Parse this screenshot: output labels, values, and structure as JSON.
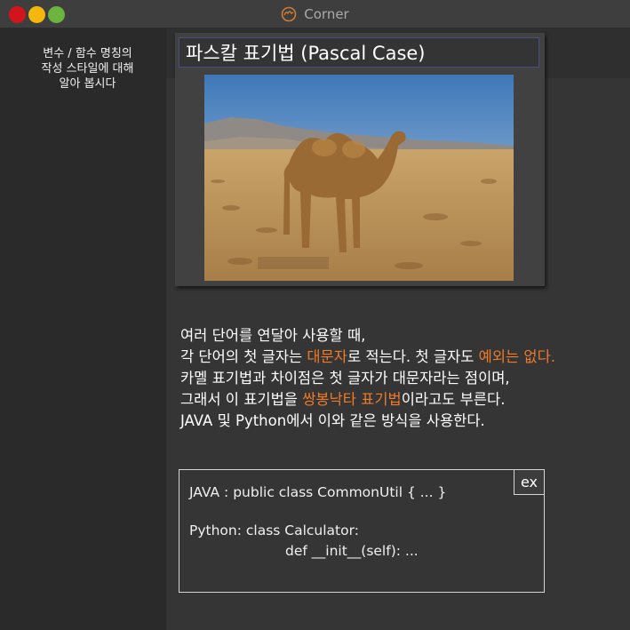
{
  "window": {
    "title": "Corner",
    "logo_icon": "camel-logo-icon"
  },
  "sidebar": {
    "lines": [
      "변수 / 함수 명칭의",
      "작성 스타일에 대해",
      "알아 봅시다"
    ]
  },
  "card": {
    "title": "파스칼 표기법 (Pascal Case)",
    "image": "camel-photo"
  },
  "description": {
    "line1": "여러 단어를 연달아 사용할 때,",
    "line2_a": "각 단어의 첫 글자는 ",
    "line2_hl1": "대문자",
    "line2_b": "로 적는다. 첫 글자도 ",
    "line2_hl2": "예외는 없다",
    "line2_c": ".",
    "line3": "카멜 표기법과 차이점은 첫 글자가 대문자라는 점이며,",
    "line4_a": "그래서 이 표기법을 ",
    "line4_hl": "쌍봉낙타 표기법",
    "line4_b": "이라고도 부른다.",
    "line5": "JAVA 및 Python에서 이와 같은 방식을 사용한다.",
    "highlight_color": "#ee7a2a"
  },
  "example": {
    "badge": "ex",
    "java": "JAVA : public class CommonUtil { ... }",
    "python1": "Python: class Calculator:",
    "python2": "def __init__(self): ..."
  }
}
